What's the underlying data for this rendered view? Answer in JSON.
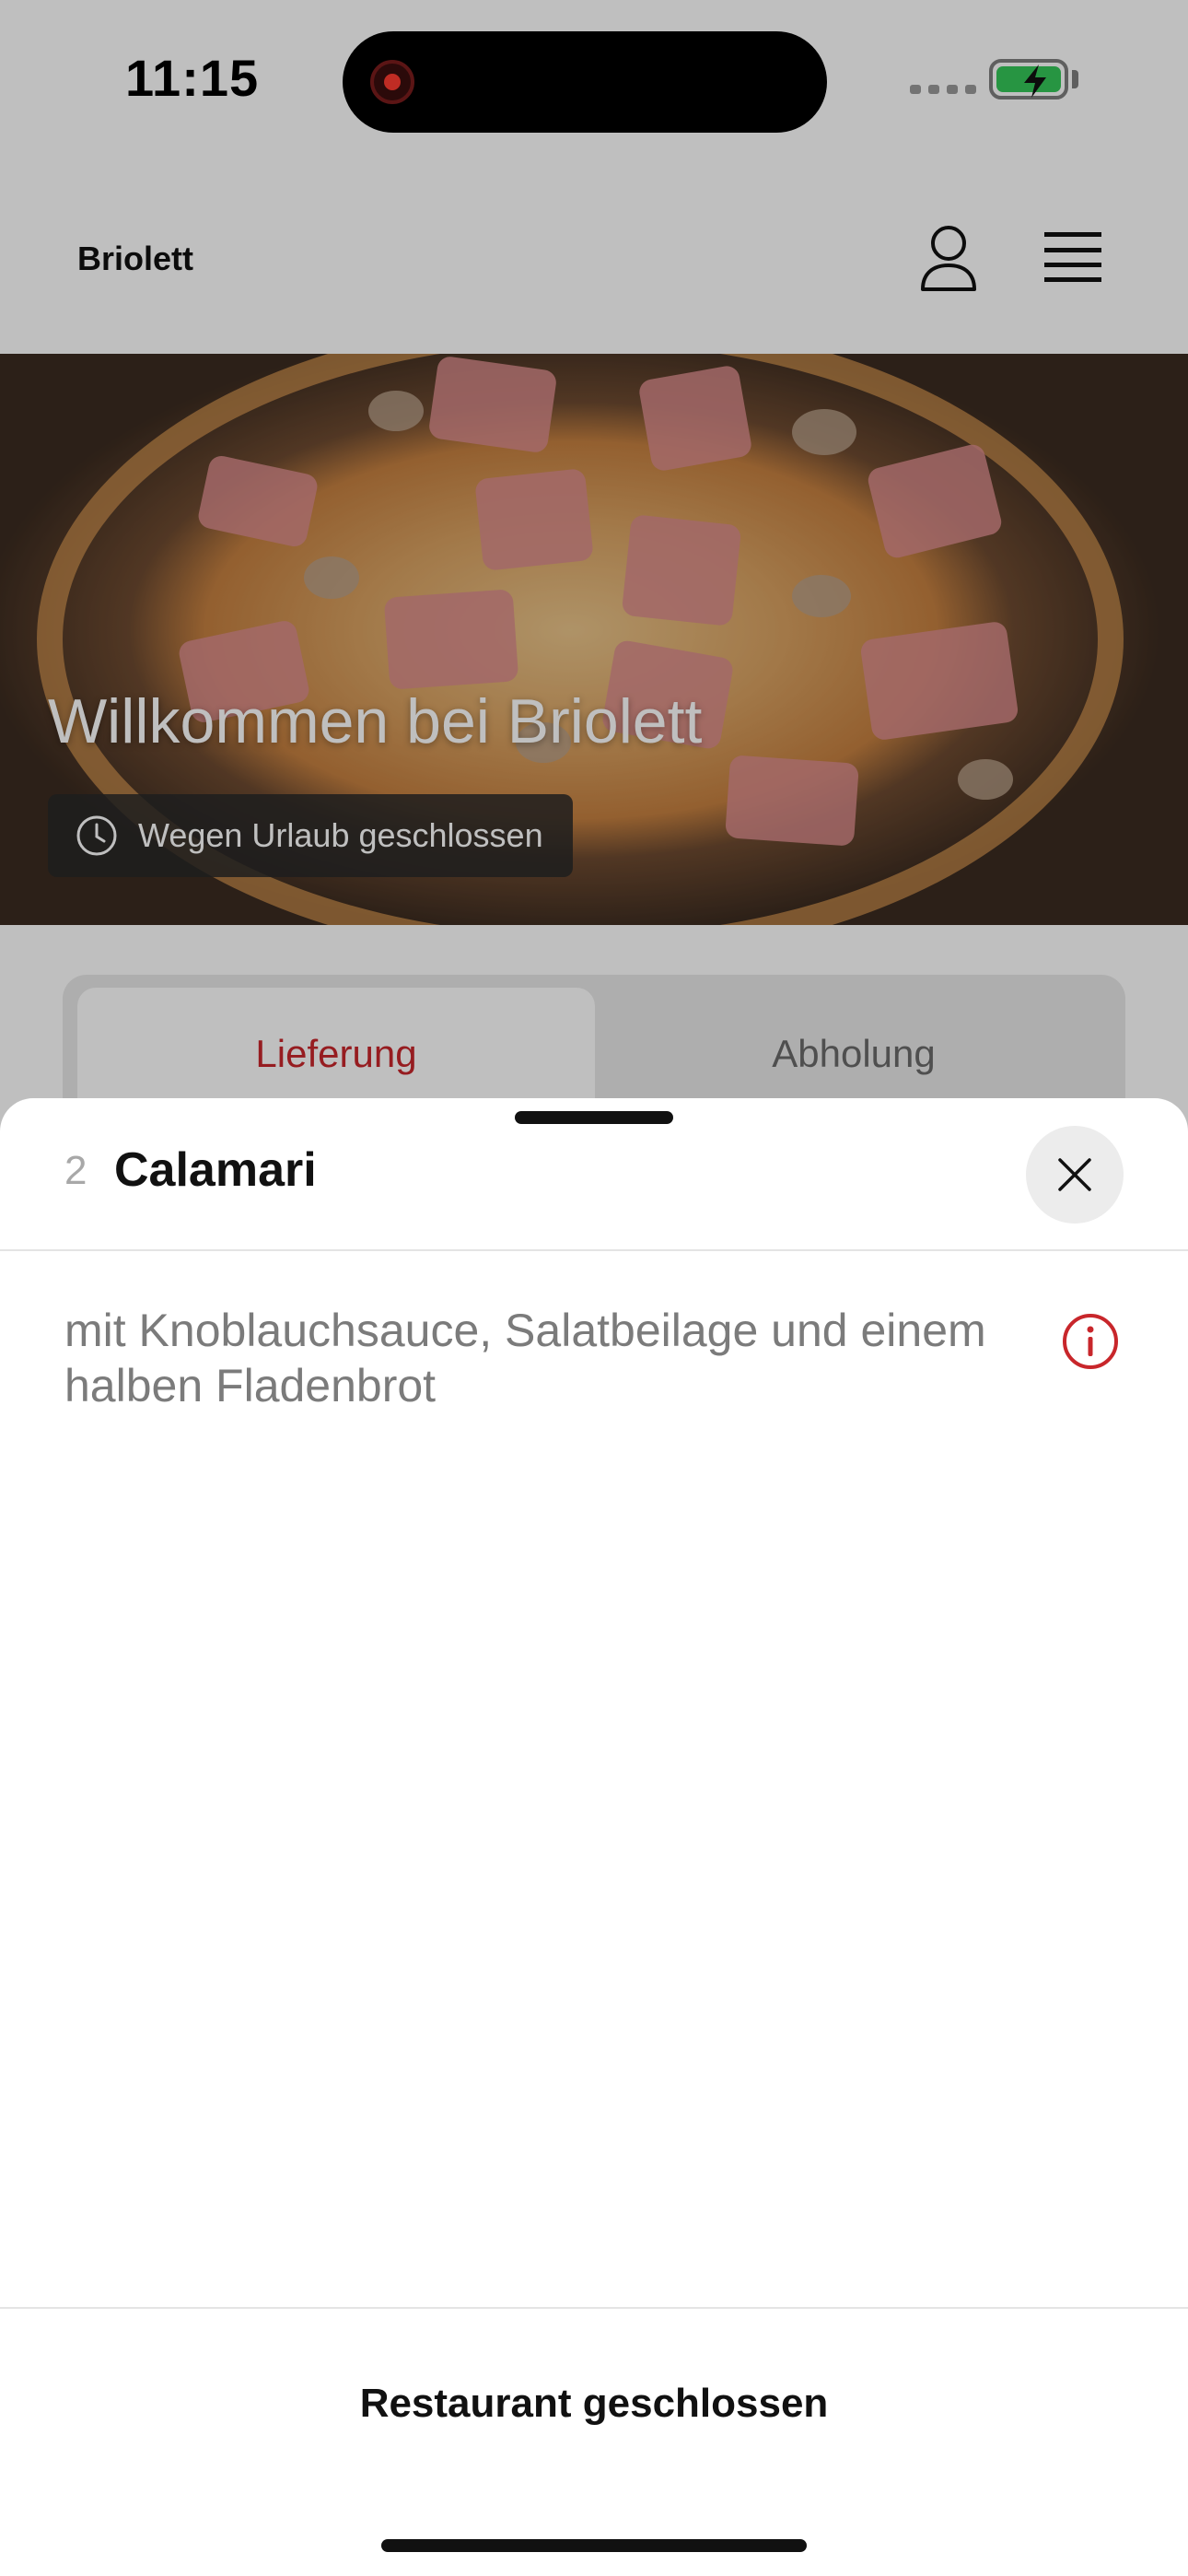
{
  "status_bar": {
    "time": "11:15"
  },
  "header": {
    "brand": "Briolett"
  },
  "hero": {
    "title": "Willkommen bei Briolett",
    "status": "Wegen Urlaub geschlossen"
  },
  "tabs": [
    {
      "label": "Lieferung",
      "active": true
    },
    {
      "label": "Abholung",
      "active": false
    }
  ],
  "sheet": {
    "item_number": "2",
    "item_title": "Calamari",
    "description": "mit Knoblauchsauce, Salatbeilage und einem halben Fladenbrot",
    "footer": "Restaurant geschlossen"
  },
  "colors": {
    "accent": "#c8262b",
    "battery": "#34c759"
  },
  "icons": [
    "record-icon",
    "signal-icon",
    "battery-icon",
    "user-icon",
    "menu-icon",
    "clock-icon",
    "close-icon",
    "info-icon"
  ]
}
